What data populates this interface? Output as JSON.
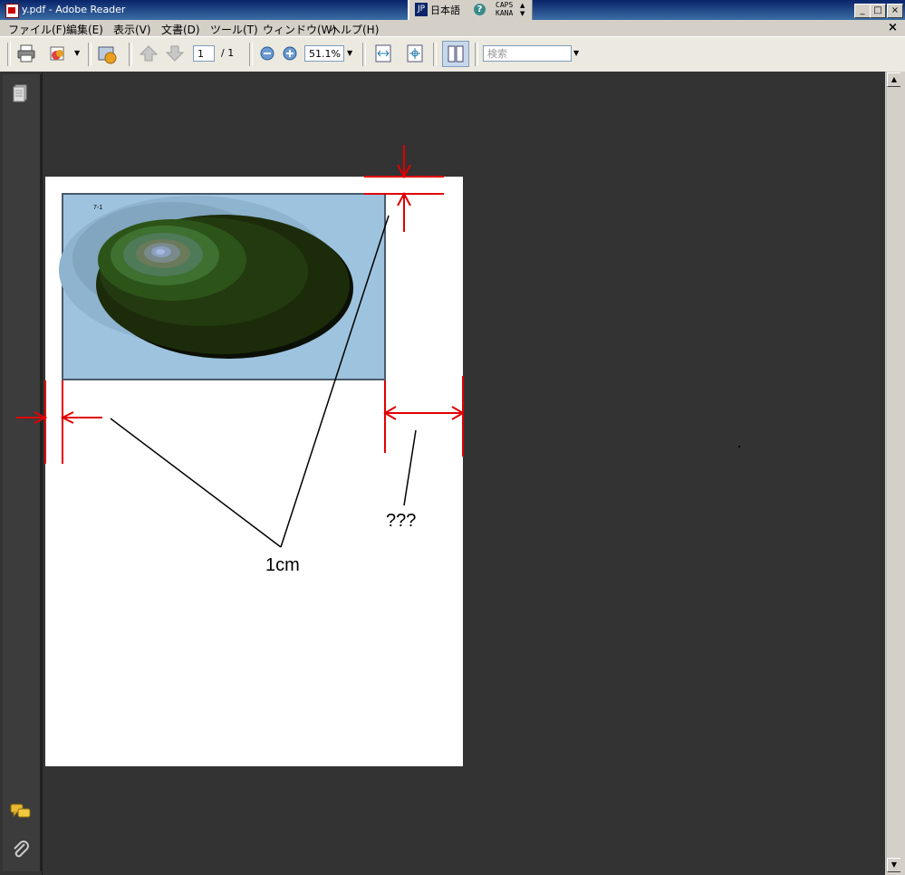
{
  "window": {
    "title": "y.pdf - Adobe Reader",
    "ime": {
      "mode": "JP",
      "language": "日本語",
      "help": "?",
      "caps": "CAPS",
      "kana": "KANA"
    },
    "controls": {
      "minimize": "_",
      "restore": "□",
      "close": "×"
    }
  },
  "menu": {
    "items": [
      "ファイル(F)",
      "編集(E)",
      "表示(V)",
      "文書(D)",
      "ツール(T)",
      "ウィンドウ(W)",
      "ヘルプ(H)"
    ],
    "doc_close": "×"
  },
  "toolbar": {
    "page_current": "1",
    "page_total": "/ 1",
    "zoom": "51.1%",
    "search_placeholder": "検索"
  },
  "document": {
    "figure_tag": "7-1",
    "annotation_1cm": "1cm",
    "annotation_question": "???"
  },
  "colors": {
    "accent_red": "#e00000",
    "figure_background": "#9dc3de",
    "viewer_background": "#333333"
  },
  "icons": [
    "print-icon",
    "email-icon",
    "organizer-icon",
    "prev-page-icon",
    "next-page-icon",
    "zoom-out-icon",
    "zoom-in-icon",
    "fit-width-icon",
    "fit-page-icon",
    "reading-mode-icon",
    "pages-panel-icon",
    "comments-icon",
    "attachments-icon"
  ]
}
